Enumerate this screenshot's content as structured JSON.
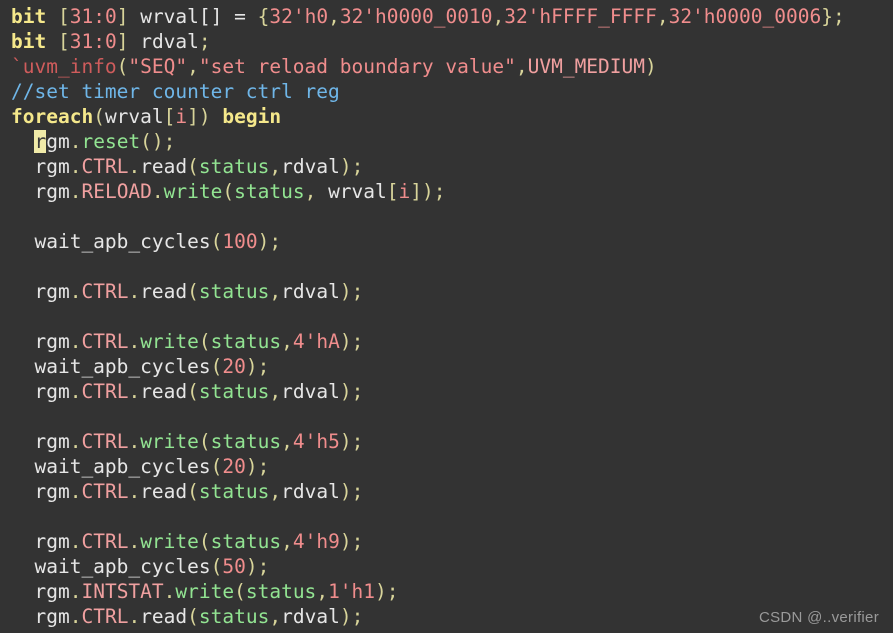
{
  "editor": {
    "background_color": "#333333",
    "font_size_px": 19.5,
    "line_height_px": 25,
    "language": "SystemVerilog / UVM",
    "cursor_char": "r",
    "colors": {
      "keyword": "#f5e88b",
      "number": "#f08d8d",
      "string": "#f08d8d",
      "comment": "#6fb6e8",
      "macro": "#cf5c5c",
      "register": "#f0a0a0",
      "method": "#92e492",
      "variable": "#92e492",
      "plain": "#e6e6e6",
      "punctuation": "#d8d49a",
      "cursor_highlight": "#f0eaa8"
    }
  },
  "lines": [
    {
      "n": 1,
      "text": "bit [31:0] wrval[] = {32'h0,32'h0000_0010,32'hFFFF_FFFF,32'h0000_0006};"
    },
    {
      "n": 2,
      "text": "bit [31:0] rdval;"
    },
    {
      "n": 3,
      "text": "`uvm_info(\"SEQ\",\"set reload boundary value\",UVM_MEDIUM)"
    },
    {
      "n": 4,
      "text": "//set timer counter ctrl reg"
    },
    {
      "n": 5,
      "text": "foreach(wrval[i]) begin"
    },
    {
      "n": 6,
      "text": "  rgm.reset();"
    },
    {
      "n": 7,
      "text": "  rgm.CTRL.read(status,rdval);"
    },
    {
      "n": 8,
      "text": "  rgm.RELOAD.write(status, wrval[i]);"
    },
    {
      "n": 9,
      "text": ""
    },
    {
      "n": 10,
      "text": "  wait_apb_cycles(100);"
    },
    {
      "n": 11,
      "text": ""
    },
    {
      "n": 12,
      "text": "  rgm.CTRL.read(status,rdval);"
    },
    {
      "n": 13,
      "text": ""
    },
    {
      "n": 14,
      "text": "  rgm.CTRL.write(status,4'hA);"
    },
    {
      "n": 15,
      "text": "  wait_apb_cycles(20);"
    },
    {
      "n": 16,
      "text": "  rgm.CTRL.read(status,rdval);"
    },
    {
      "n": 17,
      "text": ""
    },
    {
      "n": 18,
      "text": "  rgm.CTRL.write(status,4'h5);"
    },
    {
      "n": 19,
      "text": "  wait_apb_cycles(20);"
    },
    {
      "n": 20,
      "text": "  rgm.CTRL.read(status,rdval);"
    },
    {
      "n": 21,
      "text": ""
    },
    {
      "n": 22,
      "text": "  rgm.CTRL.write(status,4'h9);"
    },
    {
      "n": 23,
      "text": "  wait_apb_cycles(50);"
    },
    {
      "n": 24,
      "text": "  rgm.INTSTAT.write(status,1'h1);"
    },
    {
      "n": 25,
      "text": "  rgm.CTRL.read(status,rdval);"
    }
  ],
  "tokens": {
    "l1": {
      "kw": "bit",
      "space1": " ",
      "bracket_open": "[",
      "bits": "31:0",
      "bracket_close": "]",
      "space2": " ",
      "name": "wrval[]",
      "eq": " = ",
      "brace_open": "{",
      "v1": "32'h0",
      "c1": ",",
      "v2": "32'h0000_0010",
      "c2": ",",
      "v3": "32'hFFFF_FFFF",
      "c3": ",",
      "v4": "32'h0000_0006",
      "brace_close": "}",
      "semi": ";"
    },
    "l2": {
      "kw": "bit",
      "space1": " ",
      "bracket_open": "[",
      "bits": "31:0",
      "bracket_close": "]",
      "space2": " ",
      "name": "rdval",
      "semi": ";"
    },
    "l3": {
      "macro": "`uvm_info",
      "paren_open": "(",
      "s1": "\"SEQ\"",
      "c1": ",",
      "s2": "\"set reload boundary value\"",
      "c2": ",",
      "arg": "UVM_MEDIUM",
      "paren_close": ")"
    },
    "l4": {
      "comment": "//set timer counter ctrl reg"
    },
    "l5": {
      "kw": "foreach",
      "paren_open": "(",
      "arr": "wrval",
      "bracket_open": "[",
      "idx": "i",
      "bracket_close": "]",
      "paren_close": ")",
      "space": " ",
      "begin": "begin"
    },
    "l6": {
      "cursor": "r",
      "obj": "gm",
      "dot1": ".",
      "method": "reset",
      "parens": "()",
      "semi": ";"
    },
    "read_ctrl": {
      "obj": "rgm",
      "dot1": ".",
      "reg": "CTRL",
      "dot2": ".",
      "method": "read",
      "paren_open": "(",
      "arg1": "status",
      "comma": ",",
      "arg2": "rdval",
      "paren_close": ")",
      "semi": ";"
    },
    "write_reload": {
      "obj": "rgm",
      "dot1": ".",
      "reg": "RELOAD",
      "dot2": ".",
      "method": "write",
      "paren_open": "(",
      "arg1": "status",
      "comma": ", ",
      "arg2": "wrval",
      "bracket_open": "[",
      "idx": "i",
      "bracket_close": "]",
      "paren_close": ")",
      "semi": ";"
    },
    "wait100": {
      "fn": "wait_apb_cycles",
      "paren_open": "(",
      "num": "100",
      "paren_close": ")",
      "semi": ";"
    },
    "wait20a": {
      "fn": "wait_apb_cycles",
      "paren_open": "(",
      "num": "20",
      "paren_close": ")",
      "semi": ";"
    },
    "wait20b": {
      "fn": "wait_apb_cycles",
      "paren_open": "(",
      "num": "20",
      "paren_close": ")",
      "semi": ";"
    },
    "wait50": {
      "fn": "wait_apb_cycles",
      "paren_open": "(",
      "num": "50",
      "paren_close": ")",
      "semi": ";"
    },
    "write_ctrl_a": {
      "obj": "rgm",
      "dot1": ".",
      "reg": "CTRL",
      "dot2": ".",
      "method": "write",
      "paren_open": "(",
      "arg1": "status",
      "comma": ",",
      "val": "4'hA",
      "paren_close": ")",
      "semi": ";"
    },
    "write_ctrl_5": {
      "obj": "rgm",
      "dot1": ".",
      "reg": "CTRL",
      "dot2": ".",
      "method": "write",
      "paren_open": "(",
      "arg1": "status",
      "comma": ",",
      "val": "4'h5",
      "paren_close": ")",
      "semi": ";"
    },
    "write_ctrl_9": {
      "obj": "rgm",
      "dot1": ".",
      "reg": "CTRL",
      "dot2": ".",
      "method": "write",
      "paren_open": "(",
      "arg1": "status",
      "comma": ",",
      "val": "4'h9",
      "paren_close": ")",
      "semi": ";"
    },
    "write_intstat": {
      "obj": "rgm",
      "dot1": ".",
      "reg": "INTSTAT",
      "dot2": ".",
      "method": "write",
      "paren_open": "(",
      "arg1": "status",
      "comma": ",",
      "val": "1'h1",
      "paren_close": ")",
      "semi": ";"
    }
  },
  "watermark": {
    "text": "CSDN @..verifier"
  }
}
